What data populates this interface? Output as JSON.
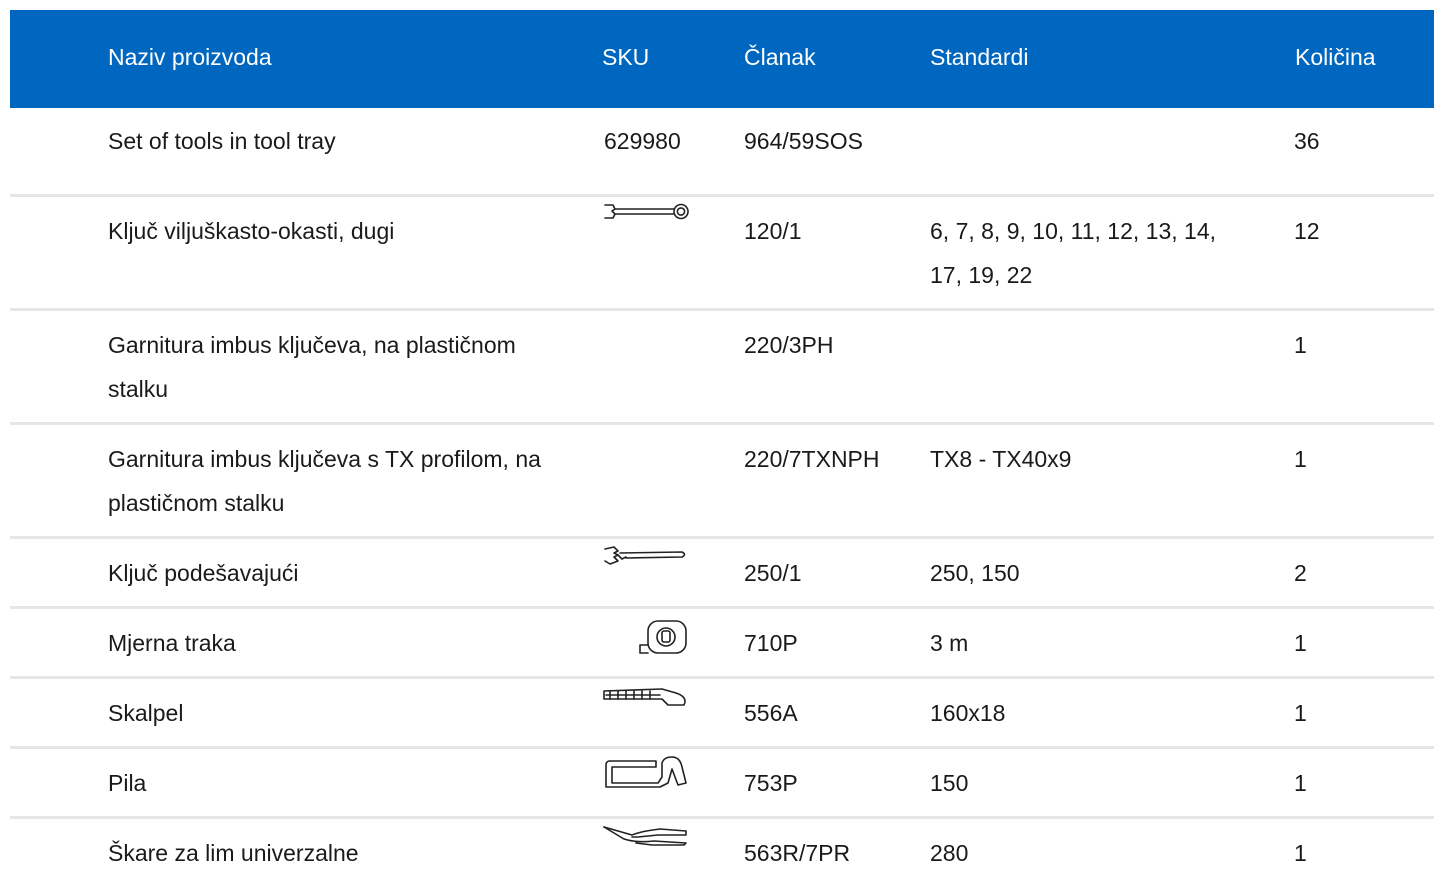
{
  "header": {
    "name": "Naziv proizvoda",
    "sku": "SKU",
    "article": "Članak",
    "standards": "Standardi",
    "quantity": "Količina"
  },
  "rows": [
    {
      "name": "Set of tools in tool tray",
      "sku": "629980",
      "article": "964/59SOS",
      "standards": "",
      "quantity": "36",
      "icon": ""
    },
    {
      "name": "Ključ viljuškasto-okasti, dugi",
      "sku": "",
      "article": "120/1",
      "standards": "6, 7, 8, 9, 10, 11, 12, 13, 14, 17, 19, 22",
      "quantity": "12",
      "icon": "combination-wrench-icon"
    },
    {
      "name": "Garnitura imbus ključeva, na plastičnom stalku",
      "sku": "",
      "article": "220/3PH",
      "standards": "",
      "quantity": "1",
      "icon": ""
    },
    {
      "name": "Garnitura imbus ključeva s TX profilom, na plastičnom stalku",
      "sku": "",
      "article": "220/7TXNPH",
      "standards": "TX8 - TX40x9",
      "quantity": "1",
      "icon": ""
    },
    {
      "name": "Ključ podešavajući",
      "sku": "",
      "article": "250/1",
      "standards": "250, 150",
      "quantity": "2",
      "icon": "adjustable-wrench-icon"
    },
    {
      "name": "Mjerna traka",
      "sku": "",
      "article": "710P",
      "standards": "3 m",
      "quantity": "1",
      "icon": "tape-measure-icon"
    },
    {
      "name": "Skalpel",
      "sku": "",
      "article": "556A",
      "standards": "160x18",
      "quantity": "1",
      "icon": "utility-knife-icon"
    },
    {
      "name": "Pila",
      "sku": "",
      "article": "753P",
      "standards": "150",
      "quantity": "1",
      "icon": "hacksaw-icon"
    },
    {
      "name": "Škare za lim univerzalne",
      "sku": "",
      "article": "563R/7PR",
      "standards": "280",
      "quantity": "1",
      "icon": "tin-snips-icon"
    }
  ],
  "colors": {
    "header_bg": "#0067c0",
    "header_text": "#ffffff",
    "row_border": "#e6e6e6"
  }
}
